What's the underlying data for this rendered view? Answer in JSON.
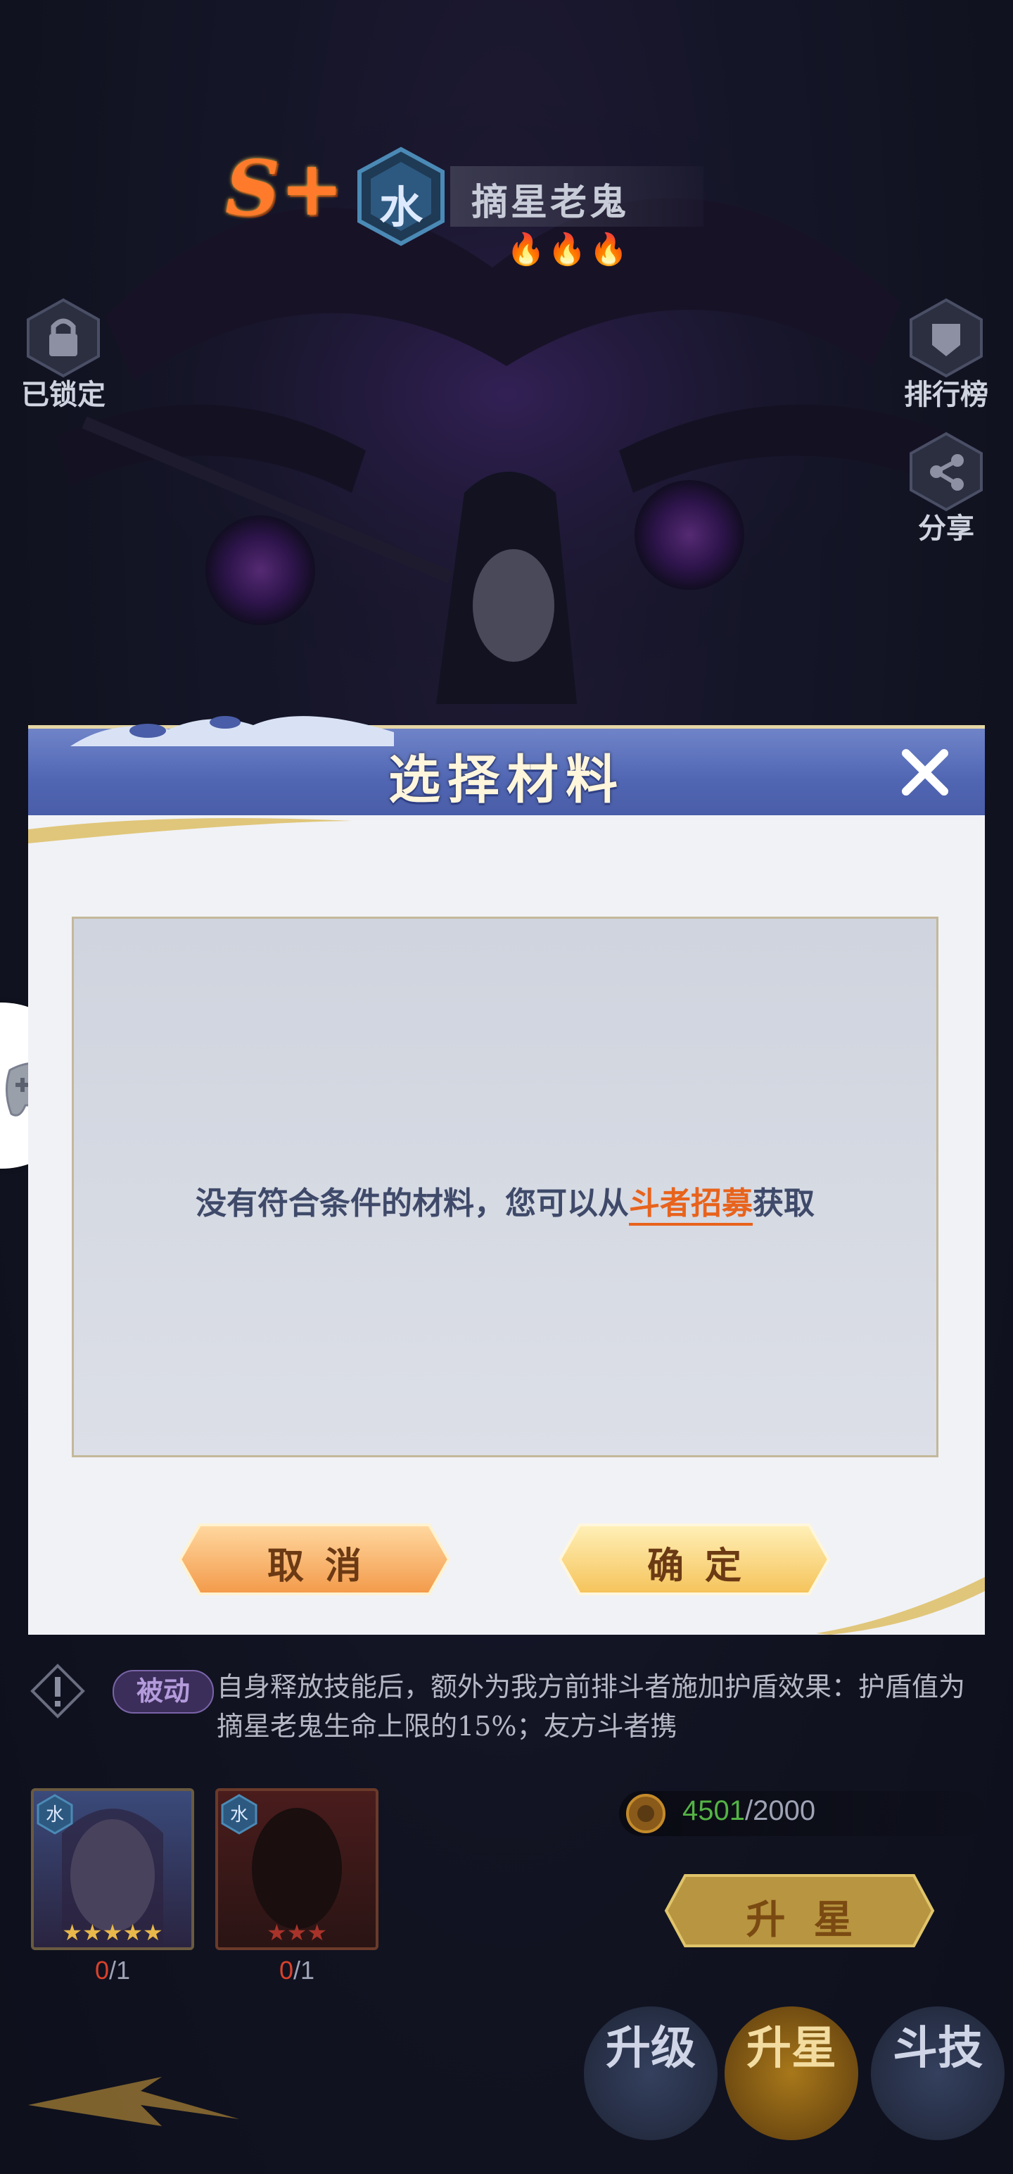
{
  "hero": {
    "rank": "S+",
    "element": "水",
    "name": "摘星老鬼",
    "stars": "🔥🔥🔥"
  },
  "side": {
    "lock_label": "已锁定",
    "rank_label": "排行榜",
    "share_label": "分享"
  },
  "dialog": {
    "title": "选择材料",
    "empty_text_before": "没有符合条件的材料，您可以从",
    "empty_link": "斗者招募",
    "empty_text_after": "获取",
    "cancel_label": "取消",
    "confirm_label": "确定"
  },
  "skill": {
    "tag": "被动",
    "text": "自身释放技能后，额外为我方前排斗者施加护盾效果：护盾值为摘星老鬼生命上限的15%；友方斗者携"
  },
  "materials": [
    {
      "element": "水",
      "have": "0",
      "need": "/1"
    },
    {
      "element": "水",
      "have": "0",
      "need": "/1"
    }
  ],
  "upgrade": {
    "coins_have": "4501",
    "coins_need": "/2000",
    "star_button": "升星"
  },
  "tabs": [
    {
      "label": "升级"
    },
    {
      "label": "升星"
    },
    {
      "label": "斗技"
    }
  ],
  "colors": {
    "dialog_header": "#5066b3",
    "link": "#e8631c",
    "button_gold": "#f7c56b"
  }
}
